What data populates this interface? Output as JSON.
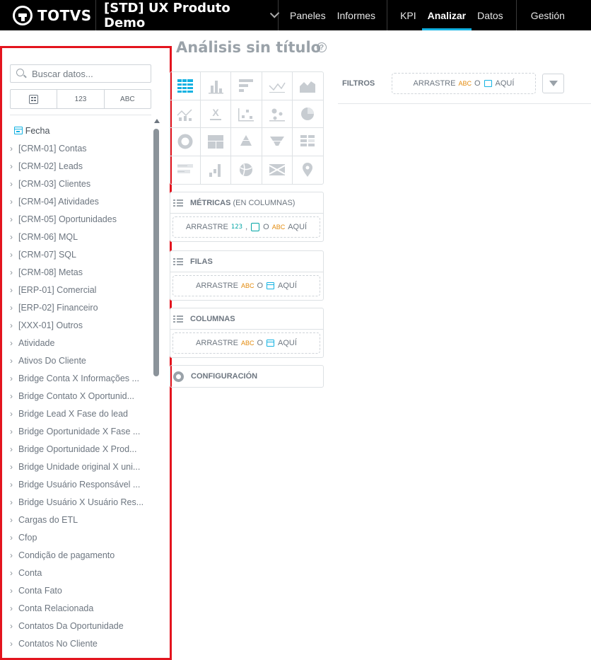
{
  "topbar": {
    "brand": "TOTVS",
    "project": "[STD] UX Produto Demo",
    "nav_main": [
      "Paneles",
      "Informes"
    ],
    "nav_modes": [
      {
        "label": "KPI",
        "active": false
      },
      {
        "label": "Analizar",
        "active": true
      },
      {
        "label": "Datos",
        "active": false
      }
    ],
    "nav_admin": "Gestión",
    "active_accent": "#14b2e2"
  },
  "catalog": {
    "search_placeholder": "Buscar datos...",
    "type_filters": {
      "metric": "123",
      "attribute": "ABC"
    },
    "date_item": "Fecha",
    "items": [
      "[CRM-01] Contas",
      "[CRM-02] Leads",
      "[CRM-03] Clientes",
      "[CRM-04] Atividades",
      "[CRM-05] Oportunidades",
      "[CRM-06] MQL",
      "[CRM-07] SQL",
      "[CRM-08] Metas",
      "[ERP-01] Comercial",
      "[ERP-02] Financeiro",
      "[XXX-01] Outros",
      "Atividade",
      "Ativos Do Cliente",
      "Bridge Conta X Informações ...",
      "Bridge Contato X Oportunid...",
      "Bridge Lead X Fase do lead",
      "Bridge Oportunidade X Fase ...",
      "Bridge Oportunidade X Prod...",
      "Bridge Unidade original X uni...",
      "Bridge Usuário Responsável ...",
      "Bridge Usuário X Usuário Res...",
      "Cargas do ETL",
      "Cfop",
      "Condição de pagamento",
      "Conta",
      "Conta Fato",
      "Conta Relacionada",
      "Contatos Da Oportunidade",
      "Contatos No Cliente"
    ],
    "highlight_color": "#e3141e"
  },
  "main": {
    "title": "Análisis sin título",
    "help": "?",
    "metrics": {
      "title": "MÉTRICAS",
      "subtitle": "(EN COLUMNAS)",
      "drop_prefix": "ARRASTRE",
      "num": "123",
      "comma": ",",
      "or": "O",
      "abc": "ABC",
      "drop_suffix": "AQUÍ"
    },
    "rows": {
      "title": "FILAS",
      "drop_prefix": "ARRASTRE",
      "abc": "ABC",
      "or": "O",
      "drop_suffix": "AQUÍ"
    },
    "columns": {
      "title": "COLUMNAS",
      "drop_prefix": "ARRASTRE",
      "abc": "ABC",
      "or": "O",
      "drop_suffix": "AQUÍ"
    },
    "config": "CONFIGURACIÓN",
    "filters": {
      "label": "FILTROS",
      "drop_prefix": "ARRASTRE",
      "abc": "ABC",
      "or": "O",
      "drop_suffix": "AQUÍ"
    }
  },
  "chart_types": [
    {
      "name": "table-icon",
      "selected": true
    },
    {
      "name": "column-chart-icon"
    },
    {
      "name": "bar-chart-icon"
    },
    {
      "name": "line-chart-icon"
    },
    {
      "name": "area-chart-icon"
    },
    {
      "name": "combo-chart-icon"
    },
    {
      "name": "headline-icon"
    },
    {
      "name": "scatter-plot-icon"
    },
    {
      "name": "bubble-chart-icon"
    },
    {
      "name": "pie-chart-icon"
    },
    {
      "name": "donut-chart-icon"
    },
    {
      "name": "treemap-icon"
    },
    {
      "name": "pyramid-icon"
    },
    {
      "name": "funnel-icon"
    },
    {
      "name": "heatmap-icon"
    },
    {
      "name": "bullet-chart-icon"
    },
    {
      "name": "waterfall-icon"
    },
    {
      "name": "dependency-wheel-icon"
    },
    {
      "name": "sankey-icon"
    },
    {
      "name": "geo-pushpin-icon"
    }
  ]
}
